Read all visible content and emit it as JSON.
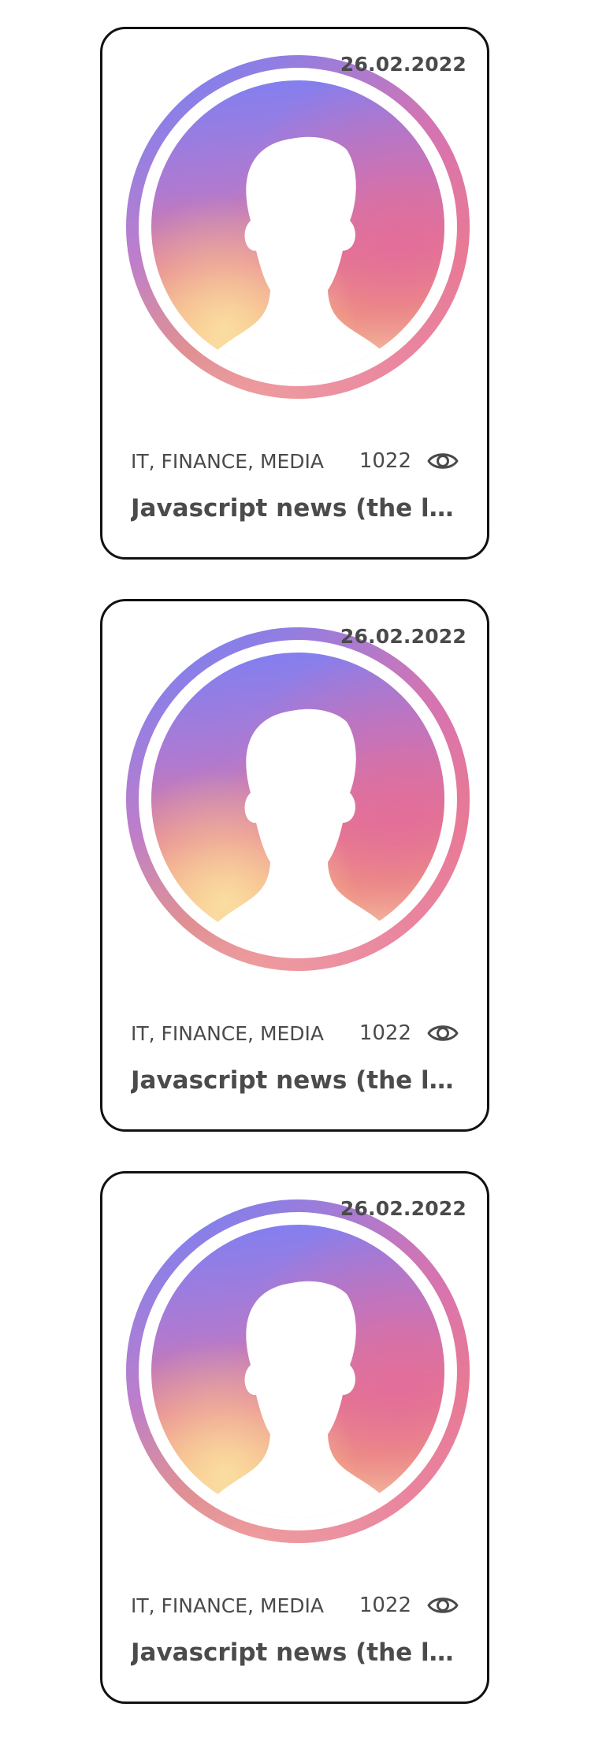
{
  "feed": {
    "cards": [
      {
        "date": "26.02.2022",
        "tags": "IT, FINANCE, MEDIA",
        "views": "1022",
        "title": "Javascript news (the lan..."
      },
      {
        "date": "26.02.2022",
        "tags": "IT, FINANCE, MEDIA",
        "views": "1022",
        "title": "Javascript news (the lan..."
      },
      {
        "date": "26.02.2022",
        "tags": "IT, FINANCE, MEDIA",
        "views": "1022",
        "title": "Javascript news (the lan..."
      }
    ]
  },
  "icons": {
    "avatar": "user-silhouette-icon",
    "views": "eye-icon"
  },
  "colors": {
    "card_border": "#111111",
    "text": "#4a4a4a",
    "gradient_violet": "#7f7ff0",
    "gradient_pink": "#e2709e",
    "gradient_orange": "#f2a070",
    "gradient_yellow": "#fbe3a4"
  }
}
